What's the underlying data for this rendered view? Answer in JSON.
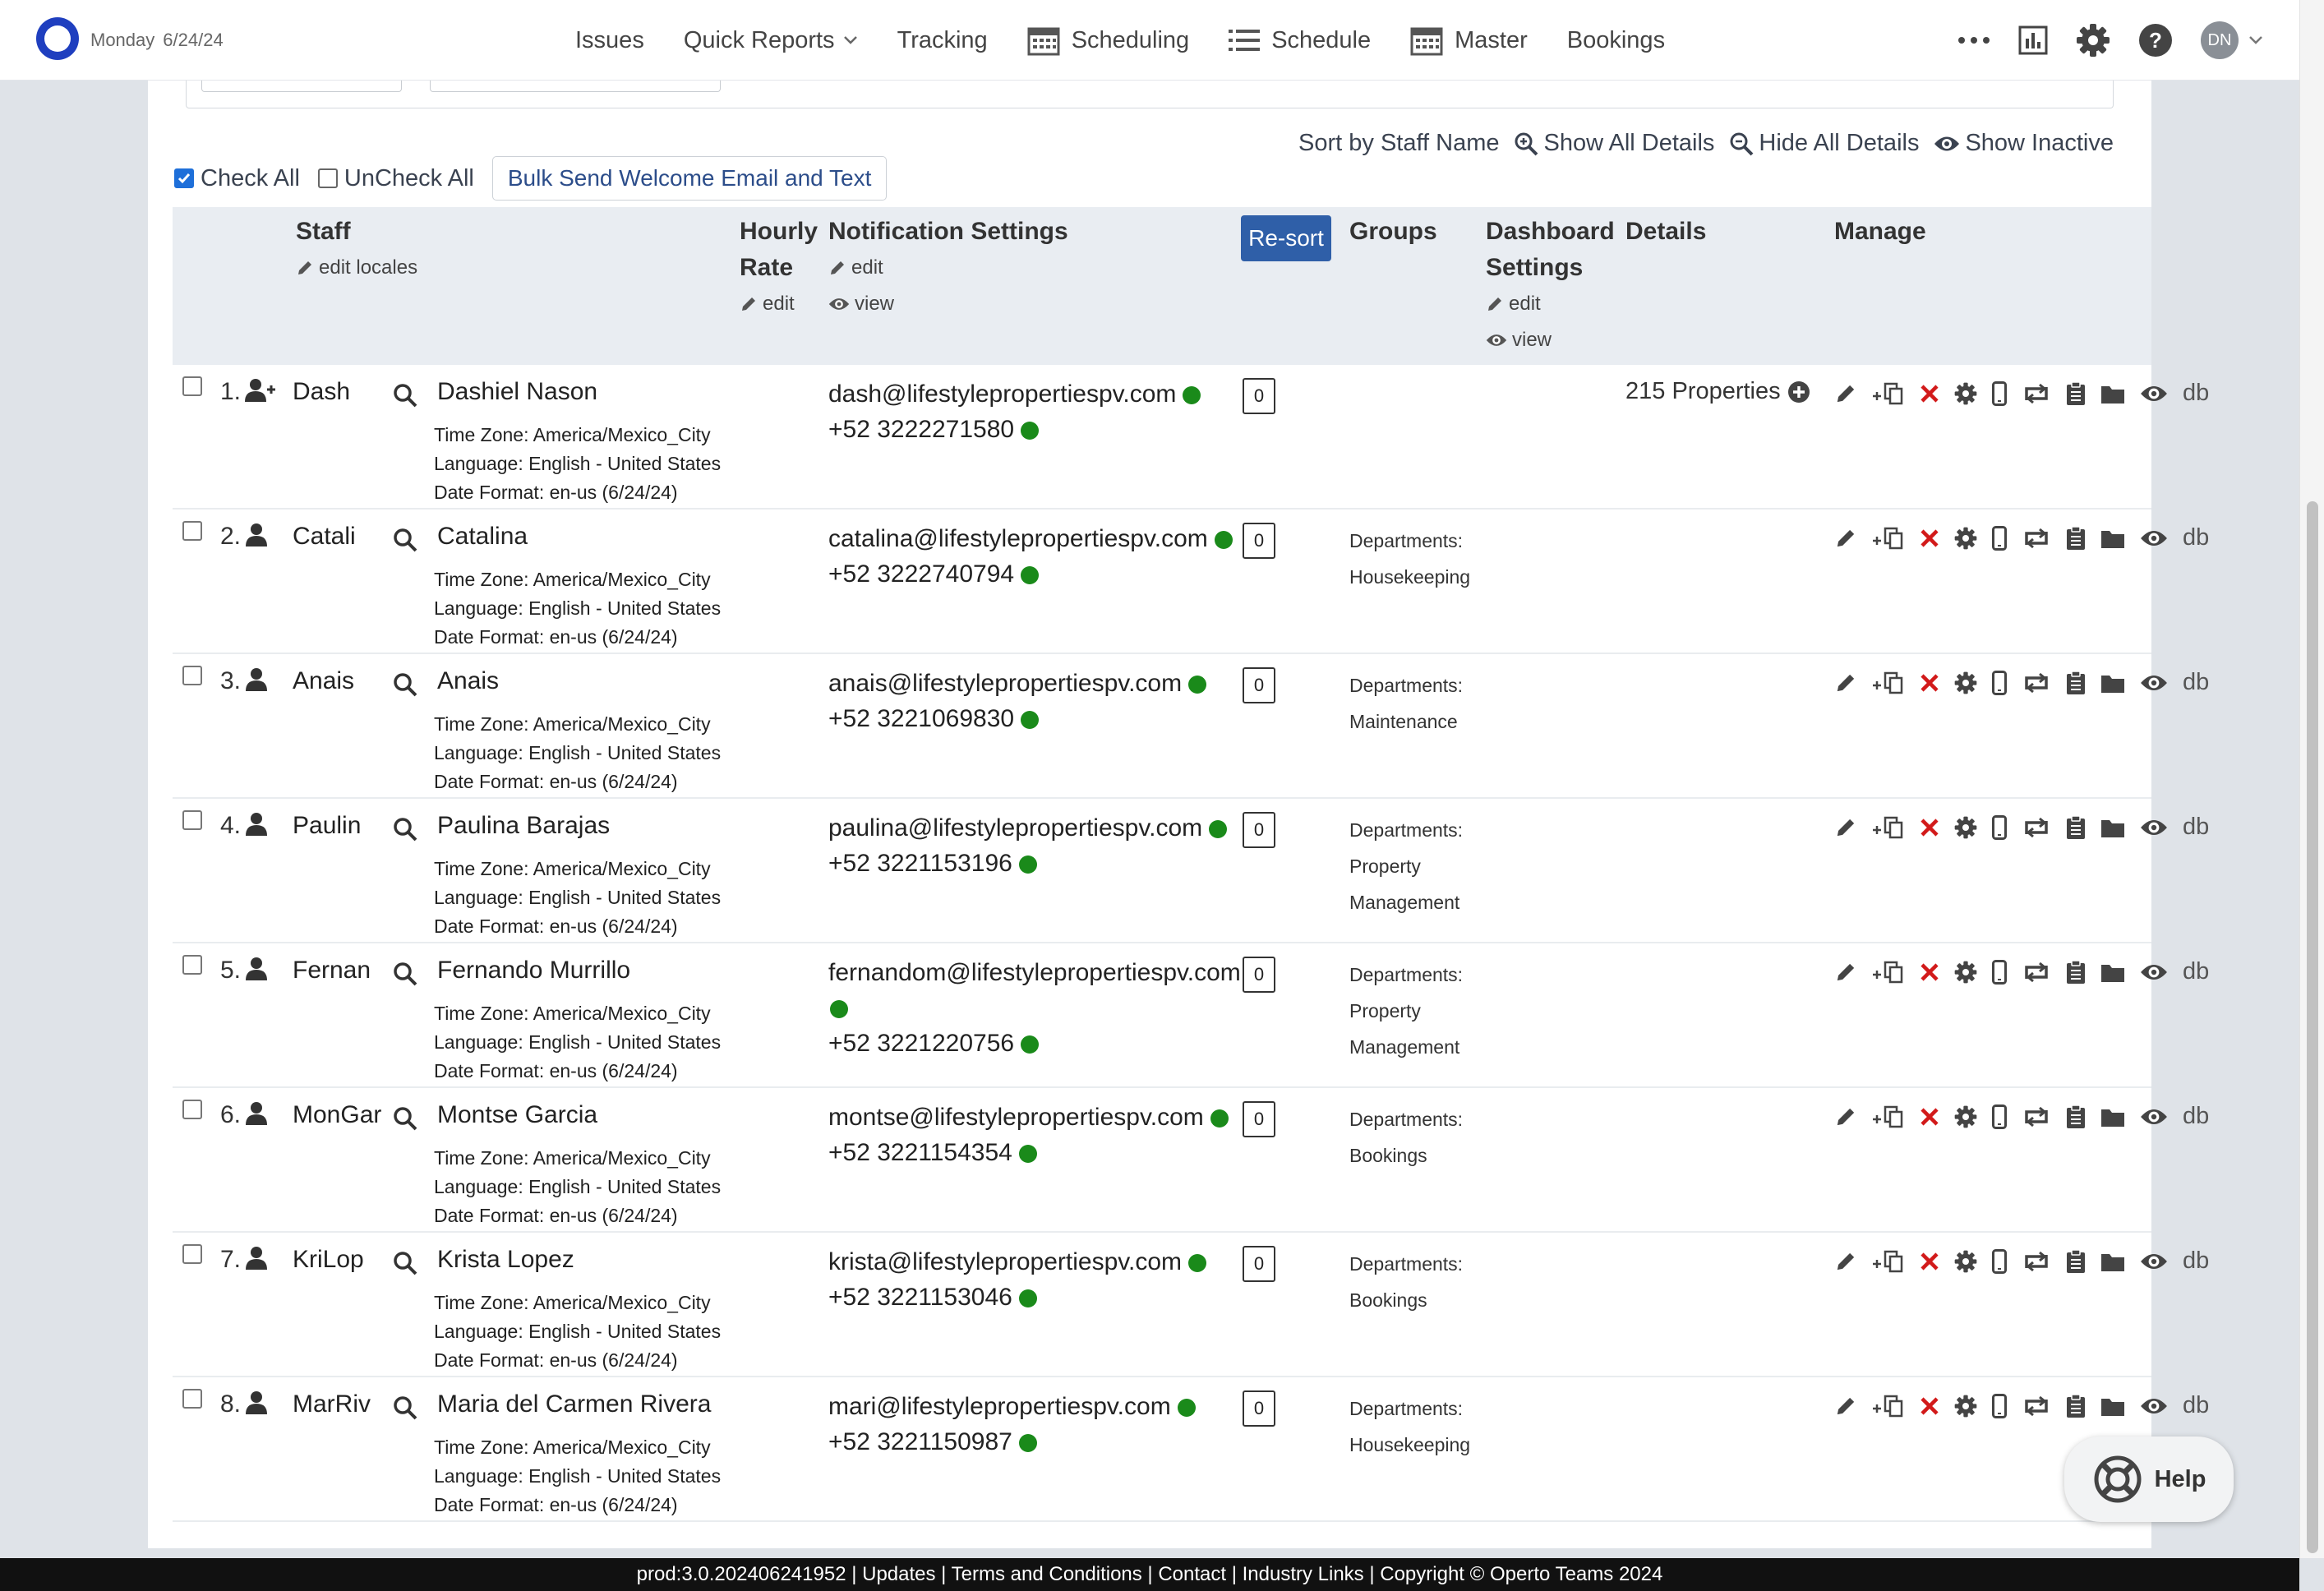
{
  "header": {
    "day": "Monday",
    "date": "6/24/24",
    "user_initials": "DN",
    "nav": [
      {
        "label": "Issues",
        "icon": ""
      },
      {
        "label": "Quick Reports",
        "icon": "chevron-down-icon"
      },
      {
        "label": "Tracking",
        "icon": ""
      },
      {
        "label": "Scheduling",
        "icon": "calendar-icon"
      },
      {
        "label": "Schedule",
        "icon": "list-icon"
      },
      {
        "label": "Master",
        "icon": "calendar-icon"
      },
      {
        "label": "Bookings",
        "icon": ""
      }
    ]
  },
  "toolbar": {
    "sort_label": "Sort by Staff Name",
    "show_all": "Show All Details",
    "hide_all": "Hide All Details",
    "show_inactive": "Show Inactive",
    "check_all": "Check All",
    "uncheck_all": "UnCheck All",
    "bulk_send": "Bulk Send Welcome Email and Text"
  },
  "columns": {
    "staff": "Staff",
    "edit_locales": "edit locales",
    "hourly1": "Hourly",
    "hourly2": "Rate",
    "edit": "edit",
    "view": "view",
    "notification": "Notification Settings",
    "resort": "Re-sort",
    "groups": "Groups",
    "dashboard1": "Dashboard",
    "dashboard2": "Settings",
    "details": "Details",
    "manage": "Manage"
  },
  "manage_db_label": "db",
  "accent_color": "#2f5fa8",
  "rows": [
    {
      "num": "1.",
      "short": "Dash",
      "name": "Dashiel Nason",
      "timezone": "Time Zone: America/Mexico_City",
      "language": "Language: English - United States",
      "date_format": "Date Format: en-us (6/24/24)",
      "email": "dash@lifestylepropertiespv.com",
      "phone": "+52 3222271580",
      "badge": "0",
      "groups_title": "",
      "groups_value": "",
      "details": "215 Properties",
      "icon": "user-plus-icon"
    },
    {
      "num": "2.",
      "short": "Catali",
      "name": "Catalina",
      "timezone": "Time Zone: America/Mexico_City",
      "language": "Language: English - United States",
      "date_format": "Date Format: en-us (6/24/24)",
      "email": "catalina@lifestylepropertiespv.com",
      "phone": "+52 3222740794",
      "badge": "0",
      "groups_title": "Departments:",
      "groups_value": "Housekeeping",
      "details": "",
      "icon": "user-icon"
    },
    {
      "num": "3.",
      "short": "Anais",
      "name": "Anais",
      "timezone": "Time Zone: America/Mexico_City",
      "language": "Language: English - United States",
      "date_format": "Date Format: en-us (6/24/24)",
      "email": "anais@lifestylepropertiespv.com",
      "phone": "+52 3221069830",
      "badge": "0",
      "groups_title": "Departments:",
      "groups_value": "Maintenance",
      "details": "",
      "icon": "user-icon"
    },
    {
      "num": "4.",
      "short": "Paulin",
      "name": "Paulina Barajas",
      "timezone": "Time Zone: America/Mexico_City",
      "language": "Language: English - United States",
      "date_format": "Date Format: en-us (6/24/24)",
      "email": "paulina@lifestylepropertiespv.com",
      "phone": "+52 3221153196",
      "badge": "0",
      "groups_title": "Departments:",
      "groups_value": "Property",
      "groups_value2": "Management",
      "details": "",
      "icon": "user-icon"
    },
    {
      "num": "5.",
      "short": "Fernan",
      "name": "Fernando Murrillo",
      "timezone": "Time Zone: America/Mexico_City",
      "language": "Language: English - United States",
      "date_format": "Date Format: en-us (6/24/24)",
      "email": "fernandom@lifestylepropertiespv.com",
      "phone": "+52 3221220756",
      "badge": "0",
      "groups_title": "Departments:",
      "groups_value": "Property",
      "groups_value2": "Management",
      "details": "",
      "icon": "user-icon",
      "email_wrap": true
    },
    {
      "num": "6.",
      "short": "MonGar",
      "name": "Montse Garcia",
      "timezone": "Time Zone: America/Mexico_City",
      "language": "Language: English - United States",
      "date_format": "Date Format: en-us (6/24/24)",
      "email": "montse@lifestylepropertiespv.com",
      "phone": "+52 3221154354",
      "badge": "0",
      "groups_title": "Departments:",
      "groups_value": "Bookings",
      "details": "",
      "icon": "user-icon"
    },
    {
      "num": "7.",
      "short": "KriLop",
      "name": "Krista Lopez",
      "timezone": "Time Zone: America/Mexico_City",
      "language": "Language: English - United States",
      "date_format": "Date Format: en-us (6/24/24)",
      "email": "krista@lifestylepropertiespv.com",
      "phone": "+52 3221153046",
      "badge": "0",
      "groups_title": "Departments:",
      "groups_value": "Bookings",
      "details": "",
      "icon": "user-icon"
    },
    {
      "num": "8.",
      "short": "MarRiv",
      "name": "Maria del Carmen Rivera",
      "timezone": "Time Zone: America/Mexico_City",
      "language": "Language: English - United States",
      "date_format": "Date Format: en-us (6/24/24)",
      "email": "mari@lifestylepropertiespv.com",
      "phone": "+52 3221150987",
      "badge": "0",
      "groups_title": "Departments:",
      "groups_value": "Housekeeping",
      "details": "",
      "icon": "user-icon"
    }
  ],
  "help_label": "Help",
  "footer": "prod:3.0.202406241952 | Updates | Terms and Conditions | Contact | Industry Links | Copyright © Operto Teams 2024"
}
